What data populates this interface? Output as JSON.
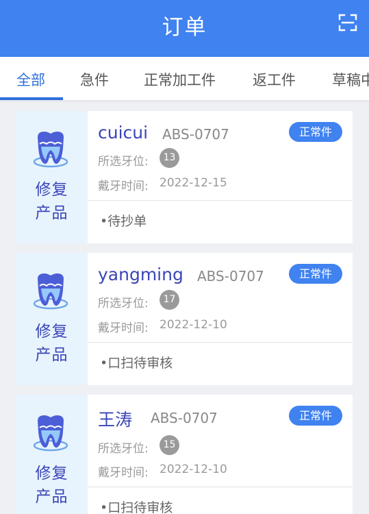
{
  "header": {
    "title": "订单",
    "scan_icon": "scan-icon"
  },
  "tabs": [
    {
      "label": "全部",
      "active": true
    },
    {
      "label": "急件",
      "active": false
    },
    {
      "label": "正常加工件",
      "active": false
    },
    {
      "label": "返工件",
      "active": false
    },
    {
      "label": "草稿中",
      "active": false
    }
  ],
  "orders": [
    {
      "side_label_line1": "修复",
      "side_label_line2": "产品",
      "name": "cuicui",
      "code": "ABS-0707",
      "badge": "正常件",
      "tooth_label": "所选牙位:",
      "tooth": "13",
      "date_label": "戴牙时间:",
      "date": "2022-12-15",
      "status": "•待抄单"
    },
    {
      "side_label_line1": "修复",
      "side_label_line2": "产品",
      "name": "yangming",
      "code": "ABS-0707",
      "badge": "正常件",
      "tooth_label": "所选牙位:",
      "tooth": "17",
      "date_label": "戴牙时间:",
      "date": "2022-12-10",
      "status": "•口扫待审核"
    },
    {
      "side_label_line1": "修复",
      "side_label_line2": "产品",
      "name": "王涛",
      "code": "ABS-0707",
      "badge": "正常件",
      "tooth_label": "所选牙位:",
      "tooth": "15",
      "date_label": "戴牙时间:",
      "date": "2022-12-10",
      "status": "•口扫待审核"
    }
  ],
  "colors": {
    "primary": "#3f82f0",
    "active_tab": "#2e6fdc",
    "name": "#3a45b8",
    "card_side_bg": "#e8f4fd"
  }
}
